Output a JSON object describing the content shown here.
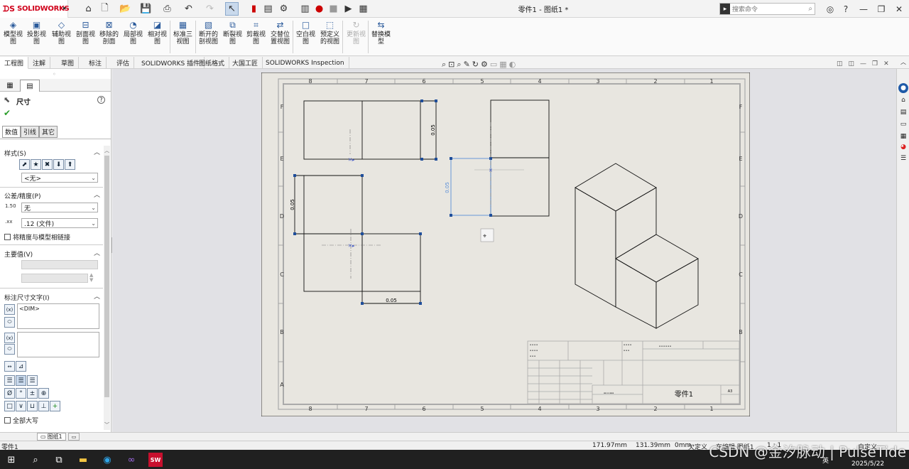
{
  "app": {
    "logo_ds": "ᗪS",
    "logo_name": "SOLIDWORKS",
    "title": "零件1 - 图纸1 *",
    "search_placeholder": "搜索命令"
  },
  "ribbon": {
    "buttons": [
      {
        "label": "模型视图",
        "icon": "model-view-icon"
      },
      {
        "label": "投影视图",
        "icon": "projected-view-icon"
      },
      {
        "label": "辅助视图",
        "icon": "auxiliary-view-icon"
      },
      {
        "label": "剖面视图",
        "icon": "section-view-icon"
      },
      {
        "label": "移除的剖面",
        "icon": "removed-section-icon"
      },
      {
        "label": "局部视图",
        "icon": "detail-view-icon"
      },
      {
        "label": "相对视图",
        "icon": "relative-view-icon"
      },
      {
        "label": "标准三视图",
        "icon": "standard-3-view-icon"
      },
      {
        "label": "断开的剖视图",
        "icon": "broken-out-section-icon"
      },
      {
        "label": "断裂视图",
        "icon": "break-view-icon"
      },
      {
        "label": "剪裁视图",
        "icon": "crop-view-icon"
      },
      {
        "label": "交替位置视图",
        "icon": "alternate-position-icon"
      },
      {
        "label": "空白视图",
        "icon": "empty-view-icon"
      },
      {
        "label": "预定义的视图",
        "icon": "predefined-view-icon"
      },
      {
        "label": "更新视图",
        "icon": "update-view-icon"
      },
      {
        "label": "替换模型",
        "icon": "replace-model-icon"
      }
    ]
  },
  "cm_tabs": [
    "工程图",
    "注解",
    "草图",
    "标注",
    "评估",
    "SOLIDWORKS 插件",
    "图纸格式",
    "大国工匠",
    "SOLIDWORKS Inspection"
  ],
  "panel": {
    "title": "尺寸",
    "help": "?",
    "tabs": [
      "数值",
      "引线",
      "其它"
    ],
    "style": {
      "header": "样式(S)",
      "value": "<无>"
    },
    "tolerance": {
      "header": "公差/精度(P)",
      "tol_type": "无",
      "precision": ".12 (文件)",
      "link_label": "将精度与模型相链接"
    },
    "primary": {
      "header": "主要值(V)"
    },
    "dimtext": {
      "header": "标注尺寸文字(I)",
      "text": "<DIM>"
    },
    "symbols": [
      "Ø",
      "°",
      "±",
      "⊕"
    ],
    "symbols2": [
      "□",
      "∨",
      "⊔",
      "⊥",
      "+"
    ],
    "allcaps_label": "全部大写"
  },
  "drawing": {
    "zone_cols": [
      "8",
      "7",
      "6",
      "5",
      "4",
      "3",
      "2",
      "1"
    ],
    "zone_rows": [
      "F",
      "E",
      "D",
      "C",
      "B",
      "A"
    ],
    "dim_value": "0.05",
    "title_block_name": "零件1",
    "title_block_size": "A3"
  },
  "sheet_tab": "图纸1",
  "status": {
    "left": "零件1",
    "x": "171.97mm",
    "y": "131.39mm",
    "z": "0mm",
    "defined": "欠定义",
    "editing": "在编辑 图纸1",
    "scale": "1 : 1",
    "units": "自定义"
  },
  "taskbar": {
    "lang": "英",
    "date": "2025/5/22"
  },
  "watermark": "CSDN @金汐脉动 | PulseTide"
}
